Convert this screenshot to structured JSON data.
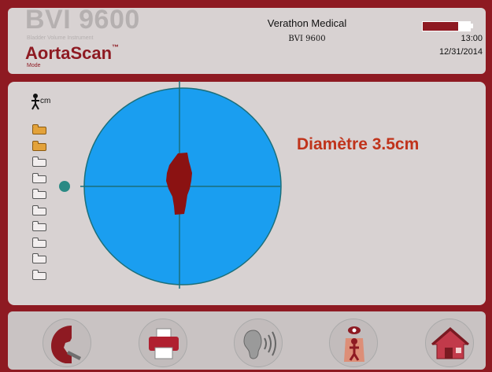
{
  "header": {
    "brand": "BVI 9600",
    "brand_sub": "Bladder Volume Instrument",
    "mode_name": "AortaScan",
    "mode_trademark": "™",
    "mode_label": "Mode",
    "vendor": "Verathon Medical",
    "model": "BVI 9600",
    "time": "13:00",
    "date": "12/31/2014",
    "battery_level": 0.75
  },
  "main": {
    "unit_label": "cm",
    "diameter_text": "Diamètre 3.5cm",
    "folders": [
      {
        "filled": true
      },
      {
        "filled": true
      },
      {
        "filled": false
      },
      {
        "filled": false
      },
      {
        "filled": false
      },
      {
        "filled": false
      },
      {
        "filled": false
      },
      {
        "filled": false
      },
      {
        "filled": false
      },
      {
        "filled": false
      }
    ]
  },
  "footer": {
    "buttons": [
      {
        "name": "scan-person-icon"
      },
      {
        "name": "printer-icon"
      },
      {
        "name": "hearing-icon"
      },
      {
        "name": "aim-person-icon"
      },
      {
        "name": "home-icon"
      }
    ]
  },
  "colors": {
    "frame": "#8e1a22",
    "panel": "#d8d2d2",
    "scan_fill": "#1a9ef0",
    "crosshair": "#1b6f7a",
    "aorta": "#8b1212",
    "diameter_text": "#c0331b"
  }
}
